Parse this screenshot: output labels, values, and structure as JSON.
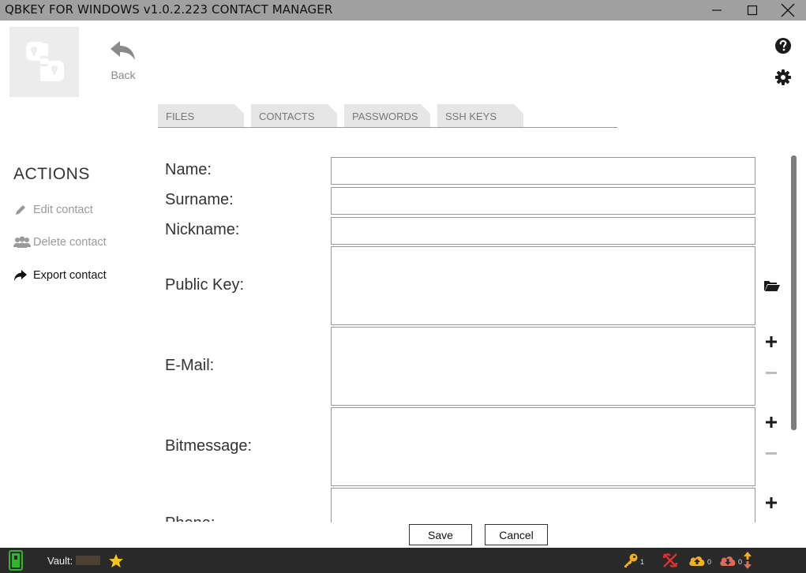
{
  "window": {
    "title": "QBKEY FOR WINDOWS v1.0.2.223  CONTACT MANAGER",
    "controls": [
      "minimize-icon",
      "maximize-icon",
      "close-icon"
    ]
  },
  "header": {
    "back_label": "Back",
    "icons": [
      "logo-icon",
      "back-arrow-icon",
      "help-icon",
      "gear-icon"
    ]
  },
  "tabs": [
    {
      "label": "FILES"
    },
    {
      "label": "CONTACTS"
    },
    {
      "label": "PASSWORDS"
    },
    {
      "label": "SSH KEYS"
    }
  ],
  "sidebar": {
    "title": "ACTIONS",
    "items": [
      {
        "label": "Edit contact",
        "icon": "pencil-icon",
        "enabled": false
      },
      {
        "label": "Delete contact",
        "icon": "users-icon",
        "enabled": false
      },
      {
        "label": "Export contact",
        "icon": "share-arrow-icon",
        "enabled": true
      }
    ]
  },
  "form": {
    "name_label": "Name:",
    "surname_label": "Surname:",
    "nickname_label": "Nickname:",
    "public_key_label": "Public Key:",
    "email_label": "E-Mail:",
    "bitmessage_label": "Bitmessage:",
    "phone_label": "Phone:",
    "name_value": "",
    "surname_value": "",
    "nickname_value": "",
    "public_key_value": "",
    "email_value": "",
    "bitmessage_value": ""
  },
  "buttons": {
    "save": "Save",
    "cancel": "Cancel"
  },
  "statusbar": {
    "vault_label": "Vault:",
    "keys_count": "1",
    "upload_count": "0",
    "download_count": "0",
    "colors": {
      "battery": "#2eb82e",
      "star": "#f5c518",
      "key": "#f0b020",
      "disconnected": "#e03030",
      "upload": "#f0b020",
      "download": "#e06a5a"
    }
  }
}
